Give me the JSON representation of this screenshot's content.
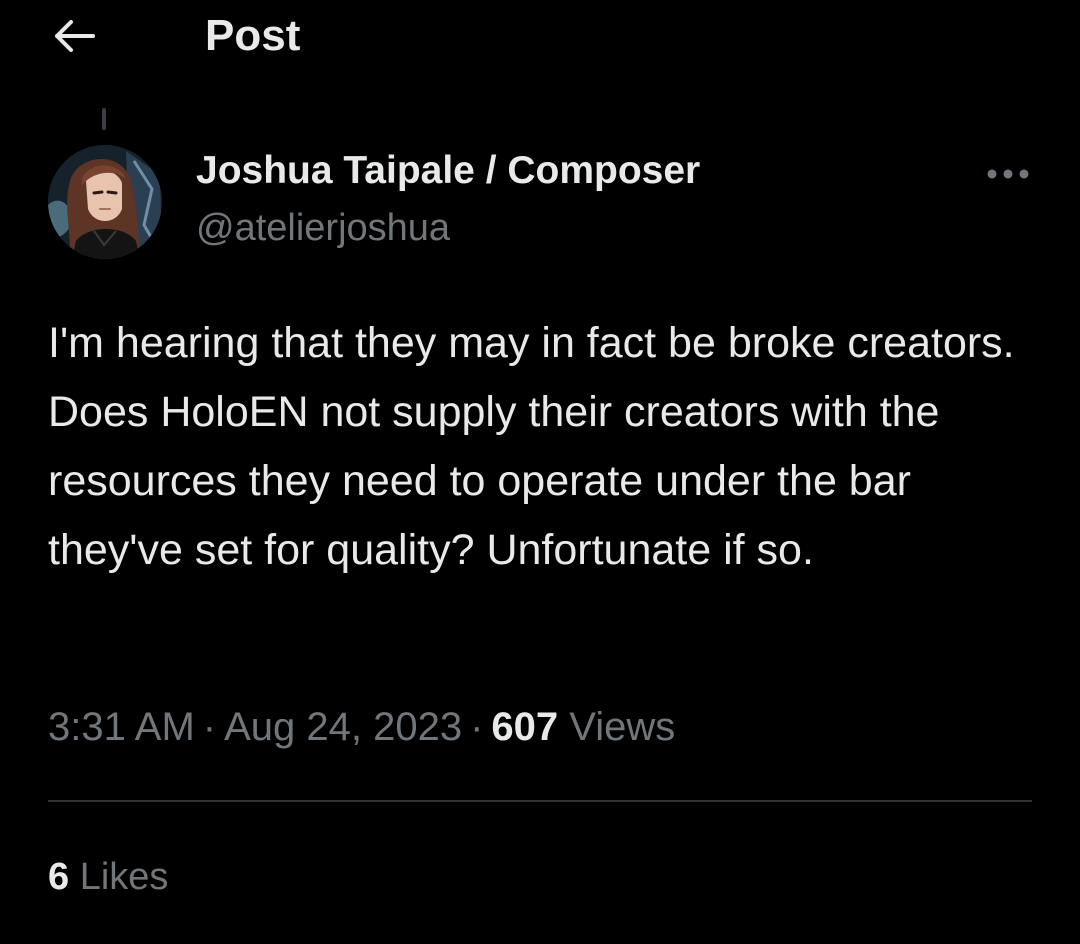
{
  "header": {
    "title": "Post",
    "back_icon": "arrow-left-icon"
  },
  "post": {
    "author": {
      "display_name": "Joshua Taipale / Composer",
      "handle": "@atelierjoshua",
      "avatar": "illustrated-portrait"
    },
    "more_icon": "more-horizontal-icon",
    "text": "I'm hearing that they may in fact be broke creators. Does HoloEN not supply their creators with the resources they need to operate under the bar they've set for quality? Unfortunate if so.",
    "time": "3:31 AM",
    "date": "Aug 24, 2023",
    "views_count": "607",
    "views_label": "Views",
    "separator": "·",
    "likes_count": "6",
    "likes_label": "Likes"
  },
  "colors": {
    "background": "#000000",
    "primary_text": "#e7e9ea",
    "secondary_text": "#71767b",
    "divider": "#2f3336"
  }
}
